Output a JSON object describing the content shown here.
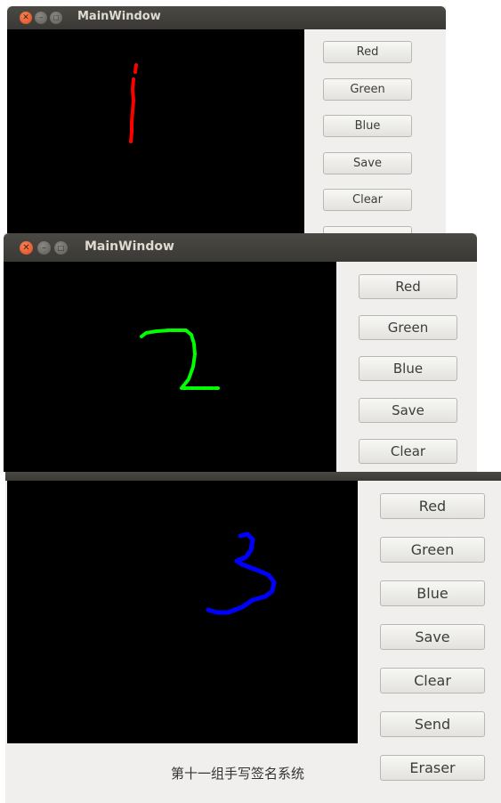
{
  "windows": [
    {
      "title": "MainWindow",
      "stroke_color": "#ff0000",
      "drawn_digit": "1",
      "buttons": [
        "Red",
        "Green",
        "Blue",
        "Save",
        "Clear"
      ]
    },
    {
      "title": "MainWindow",
      "stroke_color": "#00ff00",
      "drawn_digit": "2",
      "buttons": [
        "Red",
        "Green",
        "Blue",
        "Save",
        "Clear"
      ]
    },
    {
      "title": "",
      "stroke_color": "#0000ff",
      "drawn_digit": "3",
      "buttons": [
        "Red",
        "Green",
        "Blue",
        "Save",
        "Clear",
        "Send",
        "Eraser"
      ],
      "footer_label": "第十一组手写签名系统"
    }
  ],
  "titlebar_icons": [
    "close-icon",
    "minimize-icon",
    "maximize-icon"
  ],
  "colors": {
    "titlebar": "#3c3b37",
    "close": "#e95420",
    "canvas": "#000000",
    "panel": "#f0efed"
  }
}
